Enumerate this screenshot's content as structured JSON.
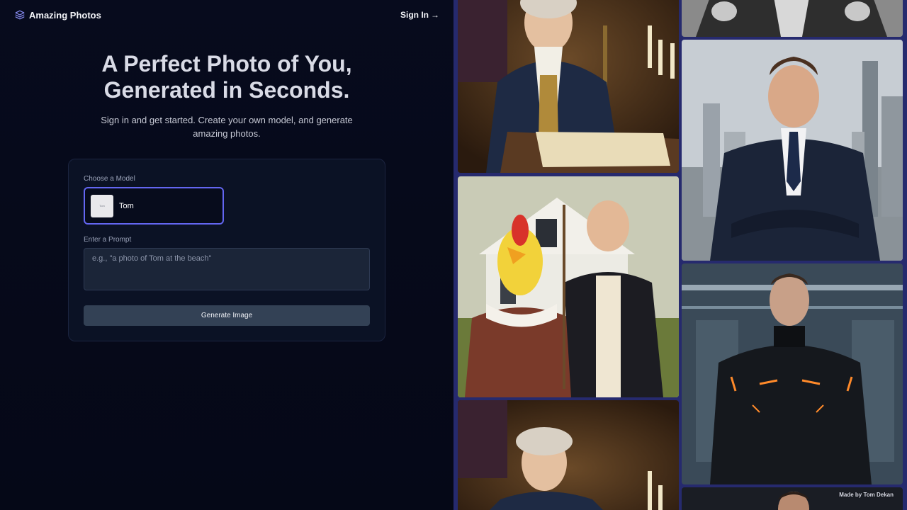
{
  "header": {
    "brand": "Amazing Photos",
    "signin_label": "Sign In",
    "signin_arrow": "→"
  },
  "hero": {
    "title_line1": "A Perfect Photo of You,",
    "title_line2": "Generated in Seconds.",
    "subtitle": "Sign in and get started. Create your own model, and generate amazing photos."
  },
  "form": {
    "model_label": "Choose a Model",
    "selected_model": "Tom",
    "thumb_text": "Tom",
    "prompt_label": "Enter a Prompt",
    "prompt_placeholder": "e.g., \"a photo of Tom at the beach\"",
    "prompt_value": "",
    "generate_label": "Generate Image"
  },
  "gallery": {
    "photos": [
      {
        "subject": "colonial-portrait-writing"
      },
      {
        "subject": "chicken-american-gothic"
      },
      {
        "subject": "colonial-portrait-repeat"
      },
      {
        "subject": "black-and-white-suit"
      },
      {
        "subject": "business-suit-city"
      },
      {
        "subject": "sci-fi-armor"
      },
      {
        "subject": "partial-portrait"
      }
    ],
    "credit": "Made by Tom Dekan"
  },
  "colors": {
    "accent": "#6366f1",
    "background": "#060a1a",
    "card": "#0b1225",
    "button": "#334155",
    "gallery_frame": "#262a6e"
  }
}
